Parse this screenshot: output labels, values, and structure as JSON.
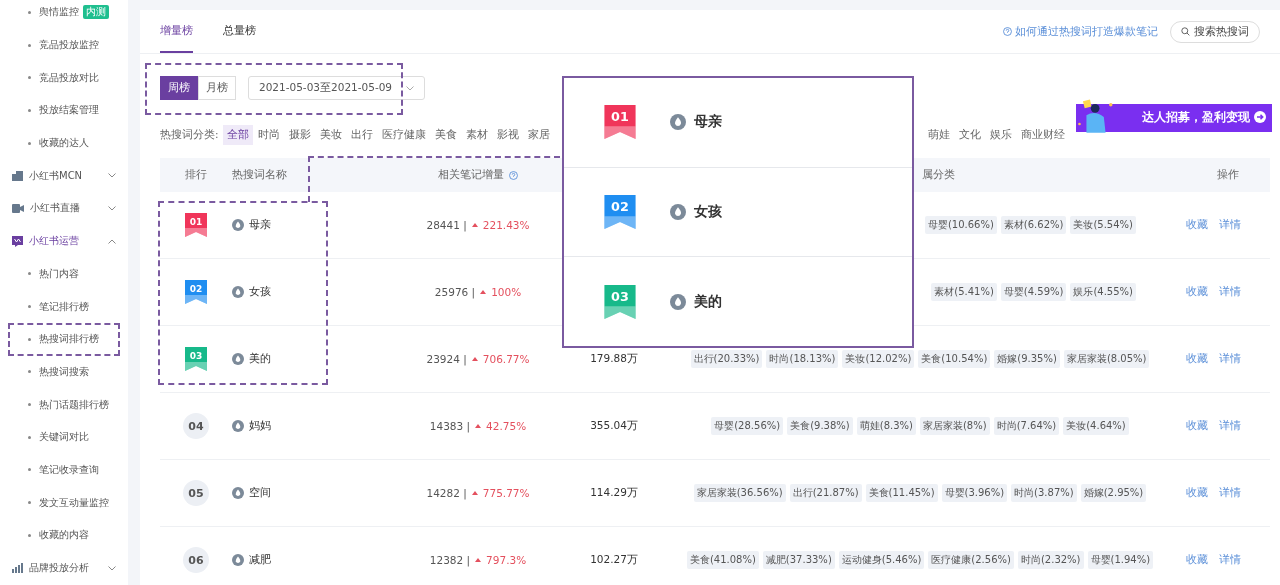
{
  "sidebar": [
    {
      "kind": "sub",
      "label": "舆情监控",
      "badge": "内测",
      "annotated": false
    },
    {
      "kind": "sub",
      "label": "竞品投放监控",
      "annotated": false
    },
    {
      "kind": "sub",
      "label": "竞品投放对比",
      "annotated": false
    },
    {
      "kind": "sub",
      "label": "投放结案管理",
      "annotated": false
    },
    {
      "kind": "sub",
      "label": "收藏的达人",
      "annotated": false
    },
    {
      "kind": "group",
      "label": "小红书MCN",
      "expanded": false
    },
    {
      "kind": "group",
      "label": "小红书直播",
      "expanded": false
    },
    {
      "kind": "group",
      "label": "小红书运营",
      "expanded": true
    },
    {
      "kind": "sub",
      "label": "热门内容",
      "annotated": false
    },
    {
      "kind": "sub",
      "label": "笔记排行榜",
      "annotated": false
    },
    {
      "kind": "sub",
      "label": "热搜词排行榜",
      "annotated": true
    },
    {
      "kind": "sub",
      "label": "热搜词搜索",
      "annotated": false
    },
    {
      "kind": "sub",
      "label": "热门话题排行榜",
      "annotated": false
    },
    {
      "kind": "sub",
      "label": "关键词对比",
      "annotated": false
    },
    {
      "kind": "sub",
      "label": "笔记收录查询",
      "annotated": false
    },
    {
      "kind": "sub",
      "label": "发文互动量监控",
      "annotated": false
    },
    {
      "kind": "sub",
      "label": "收藏的内容",
      "annotated": false
    },
    {
      "kind": "group",
      "label": "品牌投放分析",
      "expanded": false
    }
  ],
  "tabs": [
    {
      "label": "增量榜",
      "selected": true
    },
    {
      "label": "总量榜",
      "selected": false
    }
  ],
  "help_link": "如何通过热搜词打造爆款笔记",
  "search_button": "搜索热搜词",
  "toolbar": {
    "annotated": true,
    "periods": [
      {
        "label": "周榜",
        "selected": true
      },
      {
        "label": "月榜",
        "selected": false
      }
    ],
    "date_range": "2021-05-03至2021-05-09"
  },
  "banner": "达人招募，盈利变现",
  "category_label": "热搜词分类:",
  "categories": [
    {
      "label": "全部",
      "selected": true
    },
    {
      "label": "时尚",
      "selected": false
    },
    {
      "label": "摄影",
      "selected": false
    },
    {
      "label": "美妆",
      "selected": false
    },
    {
      "label": "出行",
      "selected": false
    },
    {
      "label": "医疗健康",
      "selected": false
    },
    {
      "label": "美食",
      "selected": false
    },
    {
      "label": "素材",
      "selected": false
    },
    {
      "label": "影视",
      "selected": false
    },
    {
      "label": "家居",
      "selected": false
    }
  ],
  "categories_continued": [
    {
      "label": "萌娃",
      "selected": false
    },
    {
      "label": "文化",
      "selected": false
    },
    {
      "label": "娱乐",
      "selected": false
    },
    {
      "label": "商业财经",
      "selected": false
    }
  ],
  "table": {
    "columns": [
      "排行",
      "热搜词名称",
      "相关笔记增量",
      "属分类",
      "操作"
    ],
    "rows": [
      {
        "rank": "01",
        "kind": "ribbon",
        "color": "#f0355a",
        "annotated": true,
        "name": "母亲",
        "notes": "28441 |",
        "growth": "221.43%",
        "tags": [
          "母婴(10.66%)",
          "素材(6.62%)",
          "美妆(5.54%)"
        ],
        "actions": [
          "收藏",
          "详情"
        ]
      },
      {
        "rank": "02",
        "kind": "ribbon",
        "color": "#1f8ef1",
        "annotated": true,
        "name": "女孩",
        "notes": "25976 |",
        "growth": "100%",
        "tags": [
          "素材(5.41%)",
          "母婴(4.59%)",
          "娱乐(4.55%)"
        ],
        "actions": [
          "收藏",
          "详情"
        ]
      },
      {
        "rank": "03",
        "kind": "ribbon",
        "color": "#17b98a",
        "annotated": true,
        "name": "美的",
        "notes": "23924 |",
        "growth": "706.77%",
        "total": "179.88万",
        "tags": [
          "出行(20.33%)",
          "时尚(18.13%)",
          "美妆(12.02%)",
          "美食(10.54%)",
          "婚嫁(9.35%)",
          "家居家装(8.05%)"
        ],
        "actions": [
          "收藏",
          "详情"
        ]
      },
      {
        "rank": "04",
        "kind": "circle",
        "annotated": false,
        "name": "妈妈",
        "notes": "14383 |",
        "growth": "42.75%",
        "total": "355.04万",
        "tags": [
          "母婴(28.56%)",
          "美食(9.38%)",
          "萌娃(8.3%)",
          "家居家装(8%)",
          "时尚(7.64%)",
          "美妆(4.64%)"
        ],
        "actions": [
          "收藏",
          "详情"
        ]
      },
      {
        "rank": "05",
        "kind": "circle",
        "annotated": false,
        "name": "空间",
        "notes": "14282 |",
        "growth": "775.77%",
        "total": "114.29万",
        "tags": [
          "家居家装(36.56%)",
          "出行(21.87%)",
          "美食(11.45%)",
          "母婴(3.96%)",
          "时尚(3.87%)",
          "婚嫁(2.95%)"
        ],
        "actions": [
          "收藏",
          "详情"
        ]
      },
      {
        "rank": "06",
        "kind": "circle",
        "annotated": false,
        "name": "减肥",
        "notes": "12382 |",
        "growth": "797.3%",
        "total": "102.27万",
        "tags": [
          "美食(41.08%)",
          "减肥(37.33%)",
          "运动健身(5.46%)",
          "医疗健康(2.56%)",
          "时尚(2.32%)",
          "母婴(1.94%)"
        ],
        "actions": [
          "收藏",
          "详情"
        ]
      }
    ]
  },
  "callout": [
    {
      "rank": "01",
      "name": "母亲",
      "color": "#f0355a"
    },
    {
      "rank": "02",
      "name": "女孩",
      "color": "#1f8ef1"
    },
    {
      "rank": "03",
      "name": "美的",
      "color": "#17b98a"
    }
  ]
}
